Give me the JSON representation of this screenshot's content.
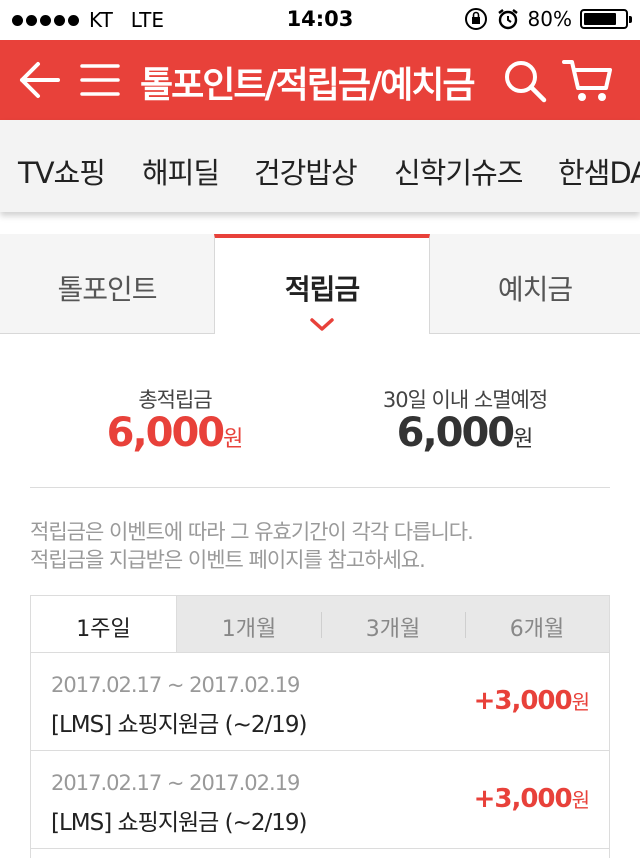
{
  "status_bar": {
    "carrier": "KT",
    "network": "LTE",
    "time": "14:03",
    "battery": "80%",
    "battery_level": 0.8,
    "icons": [
      "signal-dots-icon",
      "orientation-lock-icon",
      "alarm-icon",
      "battery-icon"
    ]
  },
  "header": {
    "title": "톨포인트/적립금/예치금",
    "background_color": "#e8413a",
    "icons": [
      "back-arrow-icon",
      "menu-icon",
      "search-icon",
      "cart-icon"
    ]
  },
  "categories": [
    "TV쇼핑",
    "해피딜",
    "건강밥상",
    "신학기슈즈",
    "한샘DA"
  ],
  "tabs": [
    {
      "label": "톨포인트",
      "active": false
    },
    {
      "label": "적립금",
      "active": true
    },
    {
      "label": "예치금",
      "active": false
    }
  ],
  "summary": {
    "total_label": "총적립금",
    "total_value": "6,000",
    "total_unit": "원",
    "expiring_label": "30일 이내 소멸예정",
    "expiring_value": "6,000",
    "expiring_unit": "원"
  },
  "notice": {
    "line1": "적립금은 이벤트에 따라 그 유효기간이 각각 다릅니다.",
    "line2": "적립금을 지급받은 이벤트 페이지를 참고하세요."
  },
  "periods": [
    {
      "label": "1주일",
      "active": true
    },
    {
      "label": "1개월",
      "active": false
    },
    {
      "label": "3개월",
      "active": false
    },
    {
      "label": "6개월",
      "active": false
    }
  ],
  "history": [
    {
      "date": "2017.02.17 ~ 2017.02.19",
      "description": "[LMS] 쇼핑지원금 (~2/19)",
      "amount": "+3,000",
      "unit": "원"
    },
    {
      "date": "2017.02.17 ~ 2017.02.19",
      "description": "[LMS] 쇼핑지원금 (~2/19)",
      "amount": "+3,000",
      "unit": "원"
    }
  ]
}
